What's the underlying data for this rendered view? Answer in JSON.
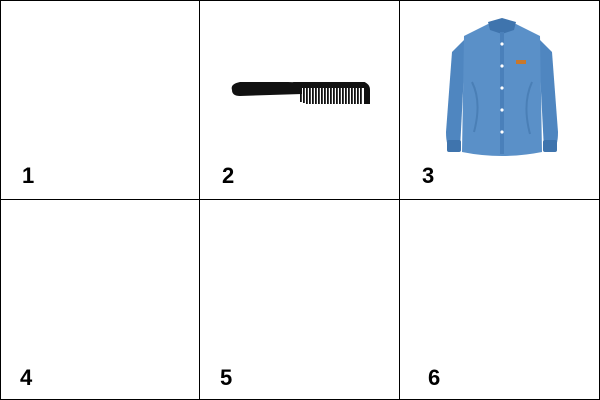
{
  "grid": {
    "cells": [
      {
        "number": "1",
        "item": ""
      },
      {
        "number": "2",
        "item": "comb-icon"
      },
      {
        "number": "3",
        "item": "shirt-icon"
      },
      {
        "number": "4",
        "item": ""
      },
      {
        "number": "5",
        "item": ""
      },
      {
        "number": "6",
        "item": ""
      }
    ]
  },
  "colors": {
    "line": "#000000",
    "shirt": "#4f86c0",
    "comb": "#111111",
    "patch": "#c8782c"
  }
}
